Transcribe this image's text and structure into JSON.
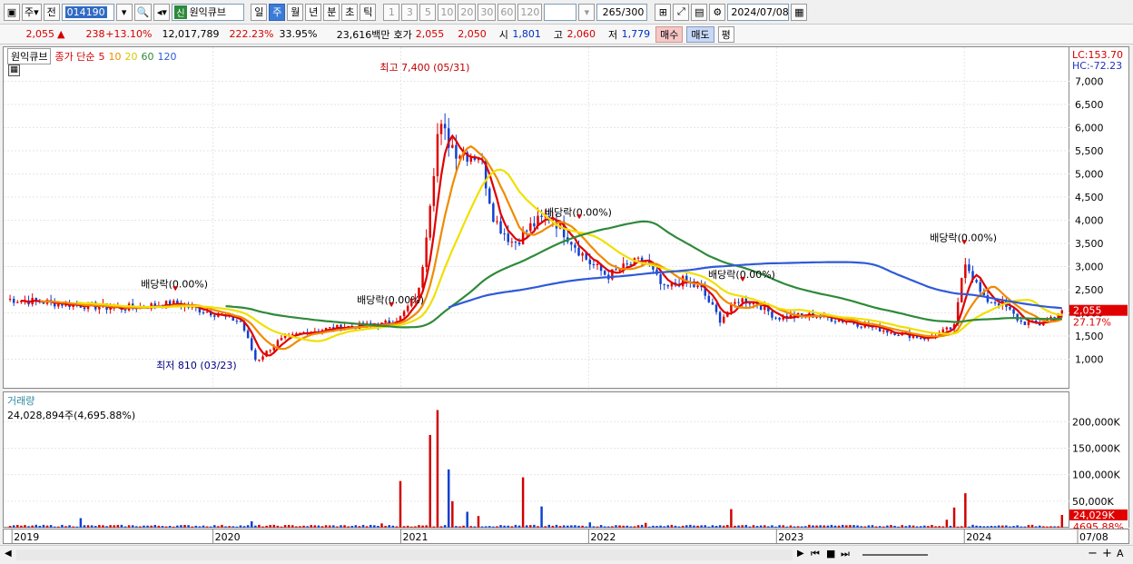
{
  "toolbar": {
    "period_type": "주",
    "prev_label": "전",
    "stock_code": "014190",
    "stock_badge": "신",
    "stock_name": "원익큐브",
    "period_buttons": [
      "일",
      "주",
      "월",
      "년",
      "분",
      "초",
      "틱"
    ],
    "active_period": "주",
    "interval_buttons": [
      "1",
      "3",
      "5",
      "10",
      "20",
      "30",
      "60",
      "120"
    ],
    "count_value": "265",
    "count_total": "/300",
    "date_value": "2024/07/08"
  },
  "quote": {
    "price": "2,055",
    "change_arrow": "▲",
    "change": "238",
    "change_pct": "+13.10%",
    "volume": "12,017,789",
    "volume_ratio": "222.23%",
    "turnover": "33.95%",
    "amount": "23,616백만",
    "bidask_label": "호가",
    "ask": "2,055",
    "bid": "2,050",
    "open_label": "시",
    "open": "1,801",
    "high_label": "고",
    "high": "2,060",
    "low_label": "저",
    "low": "1,779",
    "buy_label": "매수",
    "sell_label": "매도",
    "flat_label": "평"
  },
  "legend": {
    "name": "원익큐브",
    "ma_title": "종가 단순",
    "ma_periods": [
      "5",
      "10",
      "20",
      "60",
      "120"
    ],
    "ma_colors": [
      "#e00000",
      "#f08a00",
      "#f0e000",
      "#2f8a3a",
      "#2f5ad8"
    ]
  },
  "right_scale": {
    "lc": "LC:153.70",
    "hc": "HC:-72.23",
    "price_tag": "2,055",
    "pct_tag": "27.17%",
    "vol_tag": "24,029K",
    "vol_pct_tag": "4695.88%"
  },
  "volume_legend": {
    "title": "거래량",
    "value": "24,028,894주(4,695.88%)"
  },
  "x_labels": [
    "2019",
    "2020",
    "2021",
    "2022",
    "2023",
    "2024",
    "07/08"
  ],
  "annotations": {
    "high": "최고 7,400 (05/31)",
    "low": "최저 810 (03/23)",
    "dividend": "배당락(0.00%)"
  },
  "chart_data": [
    {
      "type": "line",
      "title": "원익큐브 주봉",
      "x": [
        2018.9,
        2019.2,
        2019.5,
        2019.8,
        2020.0,
        2020.15,
        2020.23,
        2020.35,
        2020.5,
        2020.7,
        2020.9,
        2021.0,
        2021.1,
        2021.2,
        2021.3,
        2021.42,
        2021.5,
        2021.6,
        2021.7,
        2021.8,
        2021.9,
        2022.0,
        2022.1,
        2022.2,
        2022.3,
        2022.4,
        2022.5,
        2022.6,
        2022.7,
        2022.8,
        2022.9,
        2023.0,
        2023.2,
        2023.4,
        2023.6,
        2023.8,
        2023.95,
        2024.0,
        2024.1,
        2024.2,
        2024.3,
        2024.4,
        2024.52
      ],
      "series": [
        {
          "name": "종가",
          "values": [
            2300,
            2200,
            2100,
            2200,
            2000,
            1800,
            950,
            1400,
            1600,
            1700,
            1750,
            1900,
            2500,
            6000,
            5500,
            5400,
            4000,
            3500,
            3900,
            4100,
            3600,
            3100,
            2800,
            3000,
            3150,
            2500,
            2700,
            2500,
            1850,
            2300,
            2200,
            1900,
            1950,
            1800,
            1600,
            1450,
            1700,
            3200,
            2300,
            2200,
            1800,
            1750,
            2055
          ]
        }
      ],
      "ylim": [
        500,
        7500
      ],
      "yticks": [
        1000,
        1500,
        2000,
        2500,
        3000,
        3500,
        4000,
        4500,
        5000,
        5500,
        6000,
        6500,
        7000
      ],
      "ytick_labels": [
        "1,000",
        "1,500",
        "2,000",
        "2,500",
        "3,000",
        "3,500",
        "4,000",
        "4,500",
        "5,000",
        "5,500",
        "6,000",
        "6,500",
        "7,000"
      ]
    },
    {
      "type": "bar",
      "title": "거래량",
      "x": [
        2019.3,
        2020.2,
        2020.9,
        2021.0,
        2021.15,
        2021.2,
        2021.25,
        2021.28,
        2021.35,
        2021.42,
        2021.65,
        2021.75,
        2022.0,
        2022.3,
        2022.76,
        2023.4,
        2023.9,
        2023.95,
        2024.0,
        2024.52
      ],
      "values": [
        18000,
        12000,
        8000,
        88000,
        175000,
        222000,
        110000,
        50000,
        30000,
        22000,
        95000,
        40000,
        10000,
        9000,
        35000,
        5000,
        15000,
        38000,
        65000,
        24029
      ],
      "ylim": [
        0,
        240000
      ],
      "yticks": [
        50000,
        100000,
        150000,
        200000
      ],
      "ytick_labels": [
        "50,000K",
        "100,000K",
        "150,000K",
        "200,000K"
      ]
    }
  ]
}
